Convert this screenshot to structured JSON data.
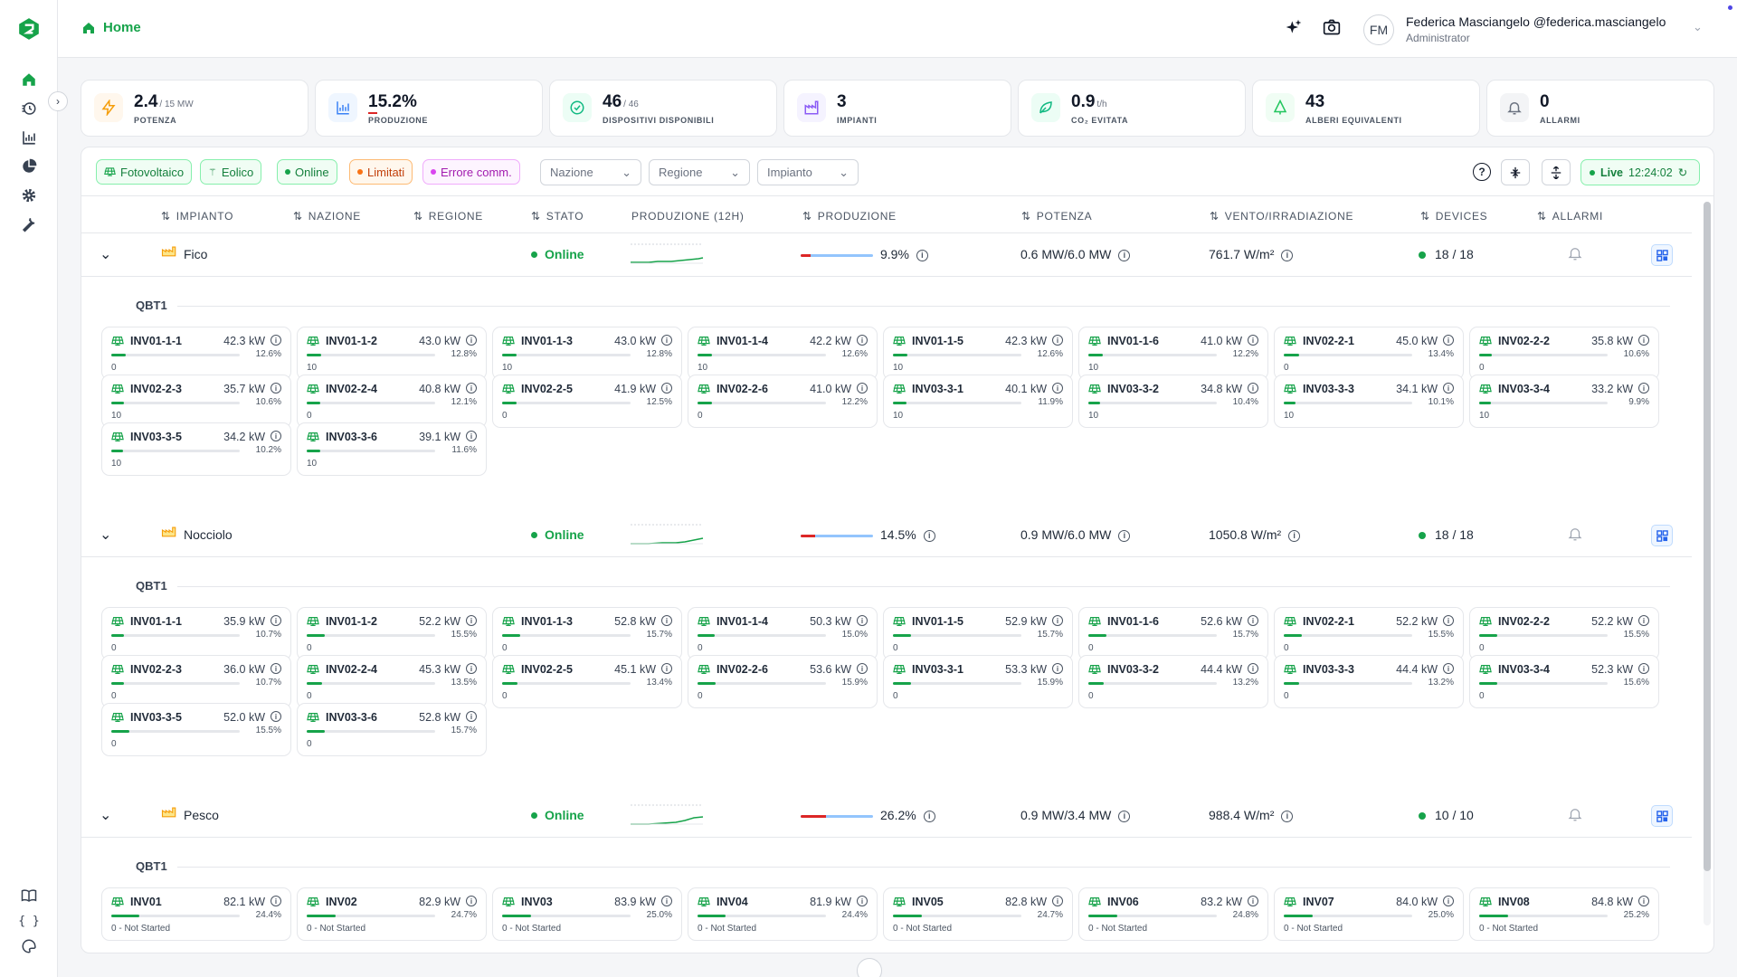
{
  "header": {
    "home_label": "Home",
    "user_initials": "FM",
    "user_name": "Federica Masciangelo @federica.masciangelo",
    "user_role": "Administrator"
  },
  "kpis": [
    {
      "value": "2.4",
      "unit": "/ 15 MW",
      "label": "POTENZA",
      "icon": "bolt-icon",
      "color": "#f59e0b",
      "bg": "#fff7ed"
    },
    {
      "value": "15.2%",
      "unit": "",
      "label": "PRODUZIONE",
      "icon": "bar-chart-icon",
      "color": "#3b82f6",
      "bg": "#eff6ff"
    },
    {
      "value": "46",
      "unit": "/ 46",
      "label": "DISPOSITIVI DISPONIBILI",
      "icon": "check-circle-icon",
      "color": "#10b981",
      "bg": "#ecfdf5"
    },
    {
      "value": "3",
      "unit": "",
      "label": "IMPIANTI",
      "icon": "factory-icon",
      "color": "#8b5cf6",
      "bg": "#f5f3ff"
    },
    {
      "value": "0.9",
      "unit": "t/h",
      "label": "CO₂ EVITATA",
      "icon": "leaf-icon",
      "color": "#10b981",
      "bg": "#ecfdf5"
    },
    {
      "value": "43",
      "unit": "",
      "label": "ALBERI EQUIVALENTI",
      "icon": "tree-icon",
      "color": "#22c55e",
      "bg": "#f0fdf4"
    },
    {
      "value": "0",
      "unit": "",
      "label": "ALLARMI",
      "icon": "bell-icon",
      "color": "#6b7280",
      "bg": "#f3f4f6"
    }
  ],
  "filters": {
    "chips": [
      "Fotovoltaico",
      "Eolico",
      "Online",
      "Limitati",
      "Errore comm."
    ],
    "selects": [
      "Nazione",
      "Regione",
      "Impianto"
    ],
    "live_label": "Live",
    "live_time": "12:24:02"
  },
  "columns": [
    "IMPIANTO",
    "NAZIONE",
    "REGIONE",
    "STATO",
    "PRODUZIONE (12H)",
    "PRODUZIONE",
    "POTENZA",
    "VENTO/IRRADIAZIONE",
    "DEVICES",
    "ALLARMI"
  ],
  "plants": [
    {
      "name": "Fico",
      "status": "Online",
      "production": "9.9%",
      "production_fraction": 0.099,
      "power": "0.6 MW/6.0 MW",
      "irradiation": "761.7 W/m²",
      "devices": "18 / 18",
      "group": "QBT1",
      "inverters": [
        {
          "name": "INV01-1-1",
          "power": "42.3 kW",
          "pct": "12.6%",
          "status": "0"
        },
        {
          "name": "INV01-1-2",
          "power": "43.0 kW",
          "pct": "12.8%",
          "status": "10"
        },
        {
          "name": "INV01-1-3",
          "power": "43.0 kW",
          "pct": "12.8%",
          "status": "10"
        },
        {
          "name": "INV01-1-4",
          "power": "42.2 kW",
          "pct": "12.6%",
          "status": "10"
        },
        {
          "name": "INV01-1-5",
          "power": "42.3 kW",
          "pct": "12.6%",
          "status": "10"
        },
        {
          "name": "INV01-1-6",
          "power": "41.0 kW",
          "pct": "12.2%",
          "status": "10"
        },
        {
          "name": "INV02-2-1",
          "power": "45.0 kW",
          "pct": "13.4%",
          "status": "0"
        },
        {
          "name": "INV02-2-2",
          "power": "35.8 kW",
          "pct": "10.6%",
          "status": "0"
        },
        {
          "name": "INV02-2-3",
          "power": "35.7 kW",
          "pct": "10.6%",
          "status": "10"
        },
        {
          "name": "INV02-2-4",
          "power": "40.8 kW",
          "pct": "12.1%",
          "status": "0"
        },
        {
          "name": "INV02-2-5",
          "power": "41.9 kW",
          "pct": "12.5%",
          "status": "0"
        },
        {
          "name": "INV02-2-6",
          "power": "41.0 kW",
          "pct": "12.2%",
          "status": "0"
        },
        {
          "name": "INV03-3-1",
          "power": "40.1 kW",
          "pct": "11.9%",
          "status": "10"
        },
        {
          "name": "INV03-3-2",
          "power": "34.8 kW",
          "pct": "10.4%",
          "status": "10"
        },
        {
          "name": "INV03-3-3",
          "power": "34.1 kW",
          "pct": "10.1%",
          "status": "10"
        },
        {
          "name": "INV03-3-4",
          "power": "33.2 kW",
          "pct": "9.9%",
          "status": "10"
        },
        {
          "name": "INV03-3-5",
          "power": "34.2 kW",
          "pct": "10.2%",
          "status": "10"
        },
        {
          "name": "INV03-3-6",
          "power": "39.1 kW",
          "pct": "11.6%",
          "status": "10"
        }
      ]
    },
    {
      "name": "Nocciolo",
      "status": "Online",
      "production": "14.5%",
      "production_fraction": 0.145,
      "power": "0.9 MW/6.0 MW",
      "irradiation": "1050.8 W/m²",
      "devices": "18 / 18",
      "group": "QBT1",
      "inverters": [
        {
          "name": "INV01-1-1",
          "power": "35.9 kW",
          "pct": "10.7%",
          "status": "0"
        },
        {
          "name": "INV01-1-2",
          "power": "52.2 kW",
          "pct": "15.5%",
          "status": "0"
        },
        {
          "name": "INV01-1-3",
          "power": "52.8 kW",
          "pct": "15.7%",
          "status": "0"
        },
        {
          "name": "INV01-1-4",
          "power": "50.3 kW",
          "pct": "15.0%",
          "status": "0"
        },
        {
          "name": "INV01-1-5",
          "power": "52.9 kW",
          "pct": "15.7%",
          "status": "0"
        },
        {
          "name": "INV01-1-6",
          "power": "52.6 kW",
          "pct": "15.7%",
          "status": "0"
        },
        {
          "name": "INV02-2-1",
          "power": "52.2 kW",
          "pct": "15.5%",
          "status": "0"
        },
        {
          "name": "INV02-2-2",
          "power": "52.2 kW",
          "pct": "15.5%",
          "status": "0"
        },
        {
          "name": "INV02-2-3",
          "power": "36.0 kW",
          "pct": "10.7%",
          "status": "0"
        },
        {
          "name": "INV02-2-4",
          "power": "45.3 kW",
          "pct": "13.5%",
          "status": "0"
        },
        {
          "name": "INV02-2-5",
          "power": "45.1 kW",
          "pct": "13.4%",
          "status": "0"
        },
        {
          "name": "INV02-2-6",
          "power": "53.6 kW",
          "pct": "15.9%",
          "status": "0"
        },
        {
          "name": "INV03-3-1",
          "power": "53.3 kW",
          "pct": "15.9%",
          "status": "0"
        },
        {
          "name": "INV03-3-2",
          "power": "44.4 kW",
          "pct": "13.2%",
          "status": "0"
        },
        {
          "name": "INV03-3-3",
          "power": "44.4 kW",
          "pct": "13.2%",
          "status": "0"
        },
        {
          "name": "INV03-3-4",
          "power": "52.3 kW",
          "pct": "15.6%",
          "status": "0"
        },
        {
          "name": "INV03-3-5",
          "power": "52.0 kW",
          "pct": "15.5%",
          "status": "0"
        },
        {
          "name": "INV03-3-6",
          "power": "52.8 kW",
          "pct": "15.7%",
          "status": "0"
        }
      ]
    },
    {
      "name": "Pesco",
      "status": "Online",
      "production": "26.2%",
      "production_fraction": 0.262,
      "power": "0.9 MW/3.4 MW",
      "irradiation": "988.4 W/m²",
      "devices": "10 / 10",
      "group": "QBT1",
      "inverters": [
        {
          "name": "INV01",
          "power": "82.1 kW",
          "pct": "24.4%",
          "status": "0 - Not Started"
        },
        {
          "name": "INV02",
          "power": "82.9 kW",
          "pct": "24.7%",
          "status": "0 - Not Started"
        },
        {
          "name": "INV03",
          "power": "83.9 kW",
          "pct": "25.0%",
          "status": "0 - Not Started"
        },
        {
          "name": "INV04",
          "power": "81.9 kW",
          "pct": "24.4%",
          "status": "0 - Not Started"
        },
        {
          "name": "INV05",
          "power": "82.8 kW",
          "pct": "24.7%",
          "status": "0 - Not Started"
        },
        {
          "name": "INV06",
          "power": "83.2 kW",
          "pct": "24.8%",
          "status": "0 - Not Started"
        },
        {
          "name": "INV07",
          "power": "84.0 kW",
          "pct": "25.0%",
          "status": "0 - Not Started"
        },
        {
          "name": "INV08",
          "power": "84.8 kW",
          "pct": "25.2%",
          "status": "0 - Not Started"
        }
      ]
    }
  ]
}
